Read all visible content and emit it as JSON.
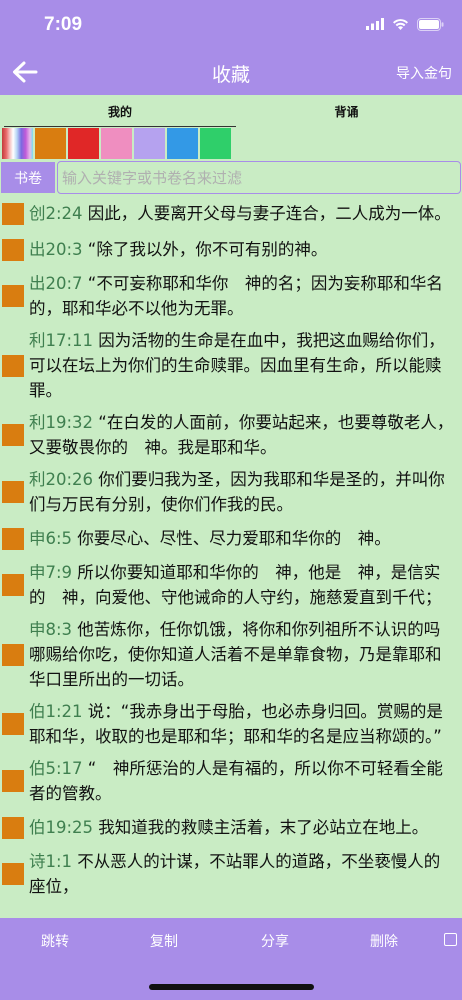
{
  "status": {
    "time": "7:09"
  },
  "header": {
    "title": "收藏",
    "import_label": "导入金句"
  },
  "tabs": [
    {
      "label": "我的"
    },
    {
      "label": "背诵"
    }
  ],
  "swatches": [
    "#multicolor",
    "#d97d10",
    "#e02727",
    "#ef8ec0",
    "#b5a2ef",
    "#3399e6",
    "#2fcf6a"
  ],
  "filter": {
    "button_label": "书卷",
    "placeholder": "输入关键字或书卷名来过滤"
  },
  "verses": [
    {
      "ref": "创2:24",
      "text": " 因此，人要离开父母与妻子连合，二人成为一体。"
    },
    {
      "ref": "出20:3",
      "text": " “除了我以外，你不可有别的神。"
    },
    {
      "ref": "出20:7",
      "text": " “不可妄称耶和华你　神的名；因为妄称耶和华名的，耶和华必不以他为无罪。"
    },
    {
      "ref": "利17:11",
      "text": " 因为活物的生命是在血中，我把这血赐给你们，可以在坛上为你们的生命赎罪。因血里有生命，所以能赎罪。"
    },
    {
      "ref": "利19:32",
      "text": " “在白发的人面前，你要站起来，也要尊敬老人，又要敬畏你的　神。我是耶和华。"
    },
    {
      "ref": "利20:26",
      "text": " 你们要归我为圣，因为我耶和华是圣的，并叫你们与万民有分别，使你们作我的民。"
    },
    {
      "ref": "申6:5",
      "text": " 你要尽心、尽性、尽力爱耶和华你的　神。"
    },
    {
      "ref": "申7:9",
      "text": " 所以你要知道耶和华你的　神，他是　神，是信实的　神，向爱他、守他诫命的人守约，施慈爱直到千代；"
    },
    {
      "ref": "申8:3",
      "text": " 他苦炼你，任你饥饿，将你和你列祖所不认识的吗哪赐给你吃，使你知道人活着不是单靠食物，乃是靠耶和华口里所出的一切话。"
    },
    {
      "ref": "伯1:21",
      "text": " 说：“我赤身出于母胎，也必赤身归回。赏赐的是耶和华，收取的也是耶和华；耶和华的名是应当称颂的。”"
    },
    {
      "ref": "伯5:17",
      "text": " “　神所惩治的人是有福的，所以你不可轻看全能者的管教。"
    },
    {
      "ref": "伯19:25",
      "text": " 我知道我的救赎主活着，末了必站立在地上。"
    },
    {
      "ref": "诗1:1",
      "text": " 不从恶人的计谋，不站罪人的道路，不坐亵慢人的座位，"
    }
  ],
  "toolbar": {
    "jump": "跳转",
    "copy": "复制",
    "share": "分享",
    "delete": "删除"
  },
  "colors": {
    "accent": "#a88de8",
    "background": "#c9ecc4",
    "mark": "#d97d10",
    "ref": "#3f7f4f"
  }
}
